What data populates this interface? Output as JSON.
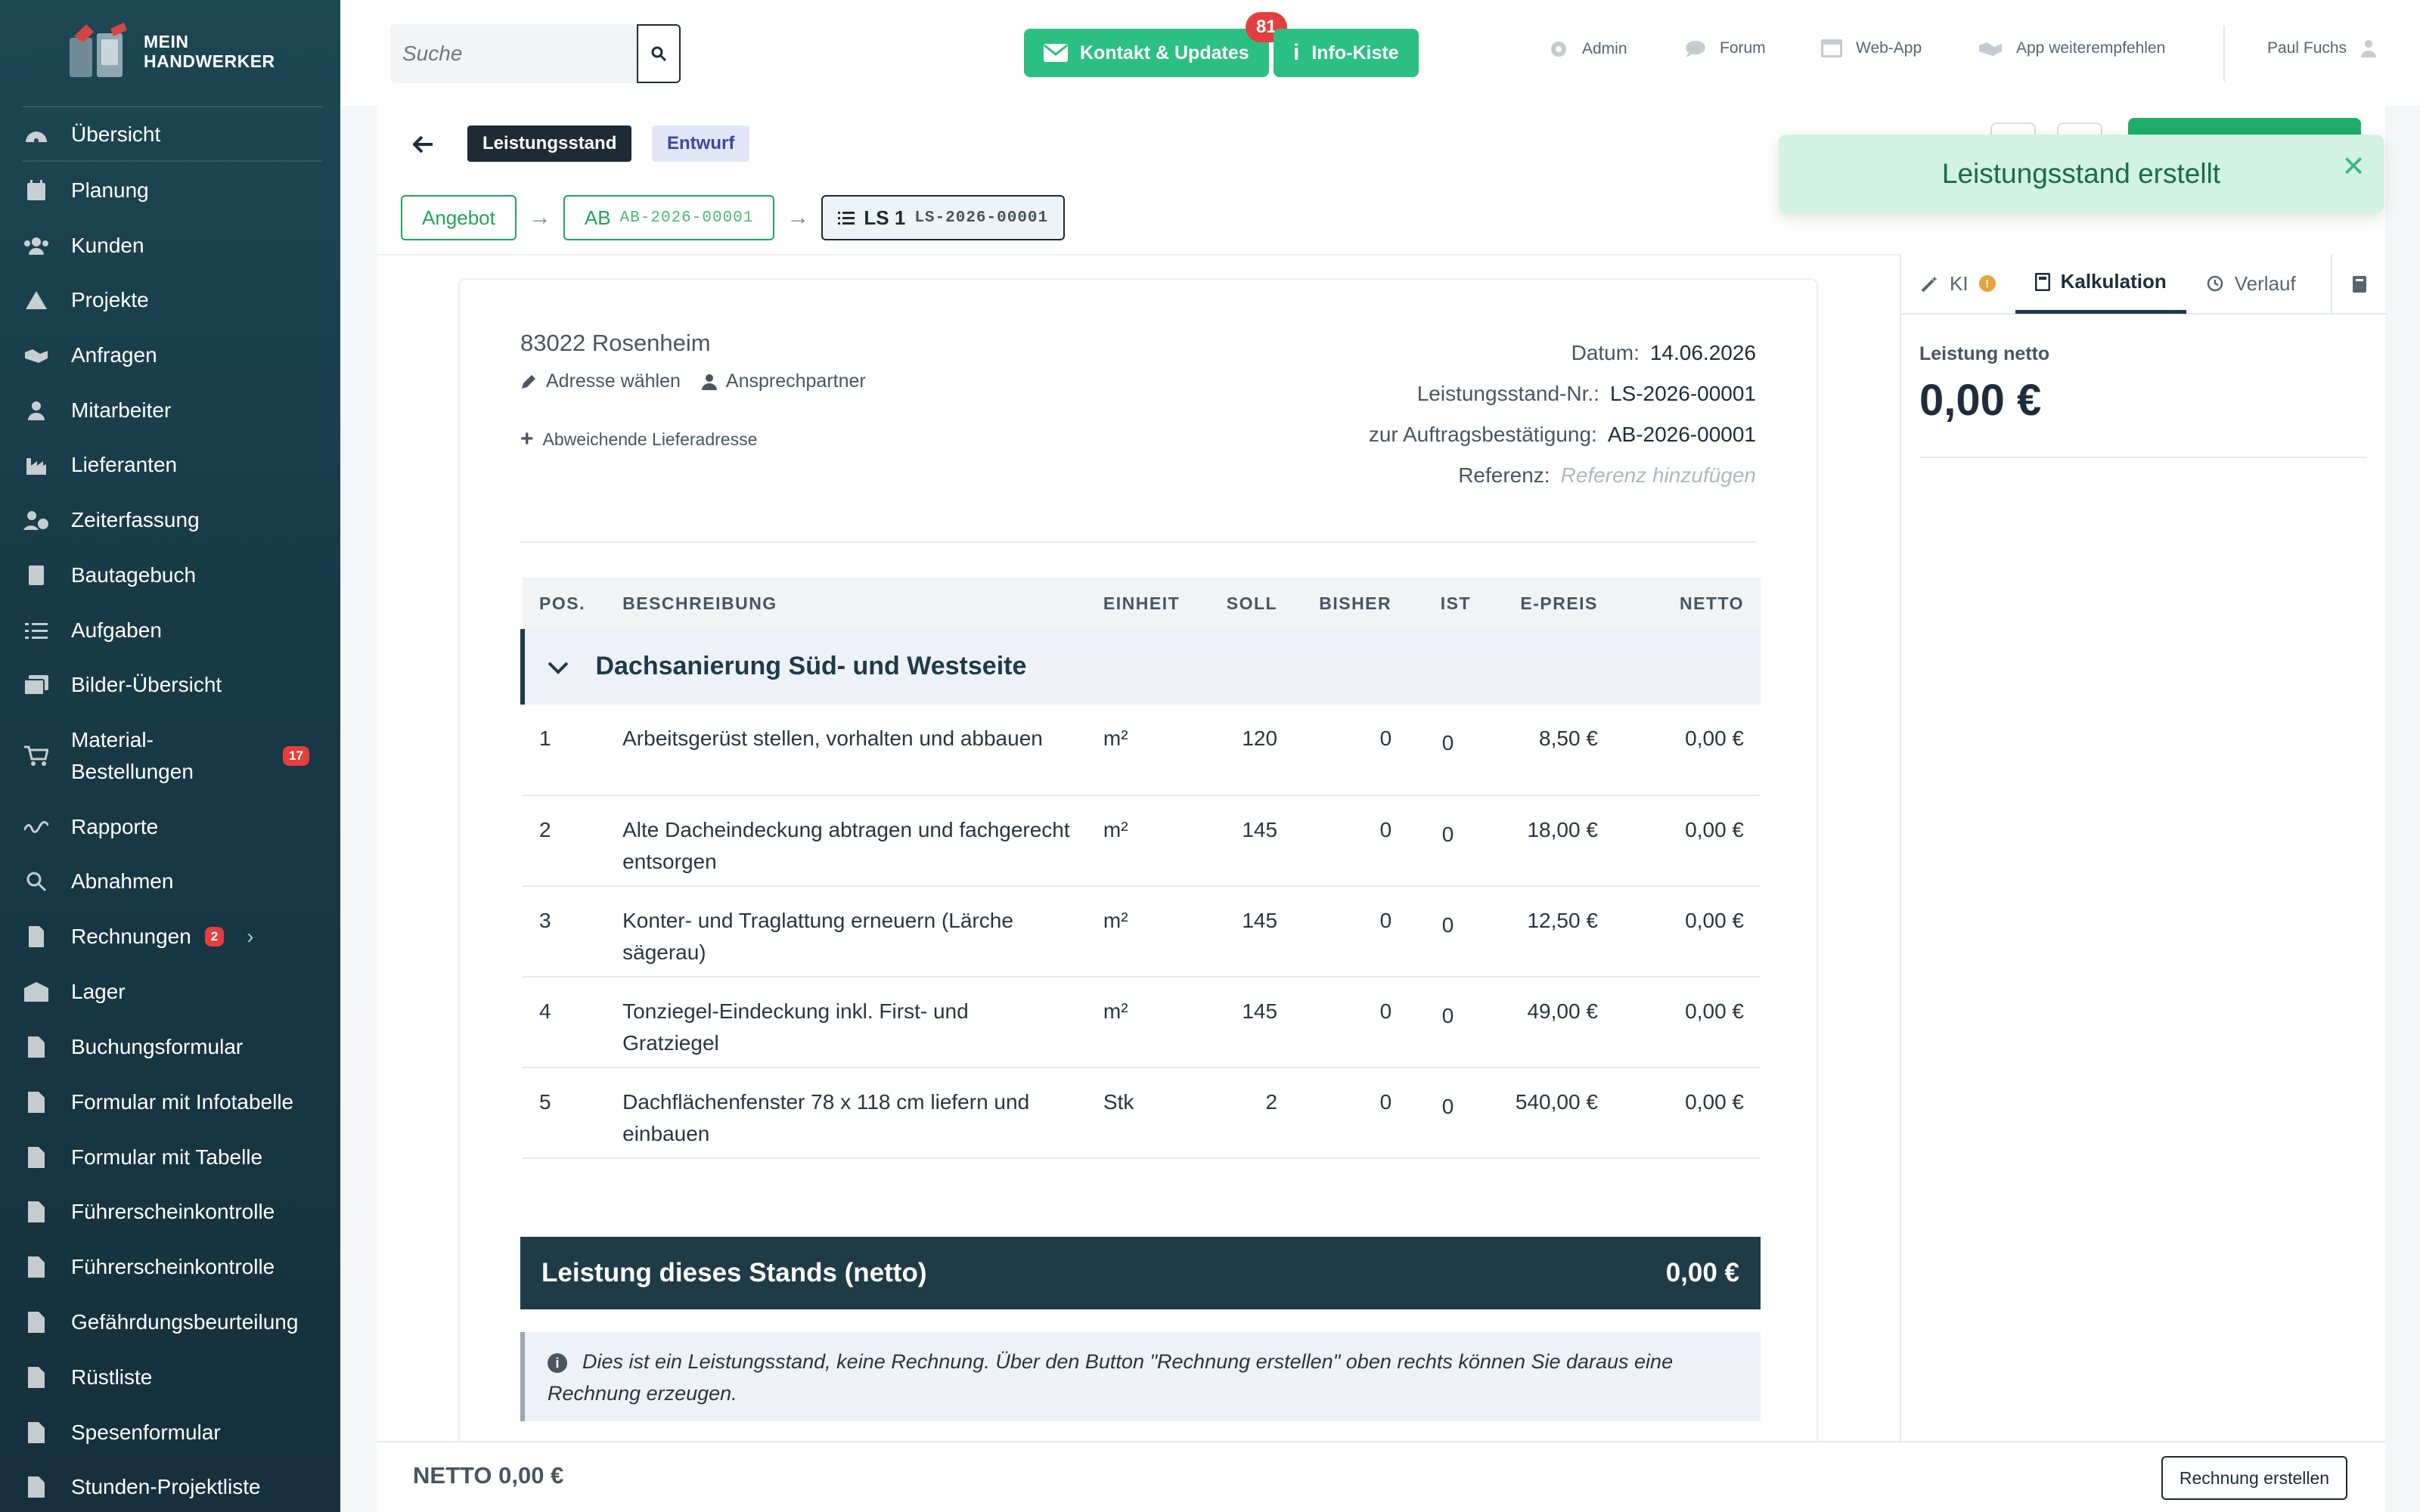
{
  "brand": {
    "line1": "MEIN",
    "line2": "HANDWERKER"
  },
  "sidebar": {
    "items": [
      {
        "label": "Übersicht",
        "icon": "dashboard-icon"
      },
      {
        "label": "Planung",
        "icon": "calendar-icon"
      },
      {
        "label": "Kunden",
        "icon": "users-icon"
      },
      {
        "label": "Projekte",
        "icon": "projects-icon"
      },
      {
        "label": "Anfragen",
        "icon": "handshake-icon"
      },
      {
        "label": "Mitarbeiter",
        "icon": "user-icon"
      },
      {
        "label": "Lieferanten",
        "icon": "industry-icon"
      },
      {
        "label": "Zeiterfassung",
        "icon": "user-clock-icon"
      },
      {
        "label": "Bautagebuch",
        "icon": "book-icon"
      },
      {
        "label": "Aufgaben",
        "icon": "tasks-icon"
      },
      {
        "label": "Bilder-Übersicht",
        "icon": "images-icon"
      },
      {
        "label": "Material-\nBestellungen",
        "icon": "cart-icon",
        "badge": "17"
      },
      {
        "label": "Rapporte",
        "icon": "signature-icon"
      },
      {
        "label": "Abnahmen",
        "icon": "search-icon"
      },
      {
        "label": "Rechnungen",
        "icon": "invoice-icon",
        "badge": "2"
      },
      {
        "label": "Lager",
        "icon": "warehouse-icon"
      },
      {
        "label": "Buchungsformular",
        "icon": "form-icon"
      },
      {
        "label": "Formular mit Infotabelle",
        "icon": "form-icon"
      },
      {
        "label": "Formular mit Tabelle",
        "icon": "form-icon"
      },
      {
        "label": "Führerscheinkontrolle",
        "icon": "form-icon"
      },
      {
        "label": "Führerscheinkontrolle",
        "icon": "form-icon"
      },
      {
        "label": "Gefährdungsbeurteilung",
        "icon": "form-icon"
      },
      {
        "label": "Rüstliste",
        "icon": "form-icon"
      },
      {
        "label": "Spesenformular",
        "icon": "form-icon"
      },
      {
        "label": "Stunden-Projektliste",
        "icon": "form-icon"
      }
    ]
  },
  "topbar": {
    "search_placeholder": "Suche",
    "contact_label": "Kontakt & Updates",
    "contact_badge": "81",
    "info_label": "Info-Kiste",
    "admin": "Admin",
    "forum": "Forum",
    "webapp": "Web-App",
    "recommend": "App weiterempfehlen",
    "user": "Paul Fuchs"
  },
  "doc": {
    "type_chip": "Leistungsstand",
    "status_chip": "Entwurf",
    "breadcrumb": {
      "angebot": "Angebot",
      "ab_label": "AB",
      "ab_number": "AB-2026-00001",
      "ls_label": "LS 1",
      "ls_number": "LS-2026-00001"
    },
    "address_city": "83022 Rosenheim",
    "choose_address": "Adresse wählen",
    "contact_person": "Ansprechpartner",
    "delivery_address": "Abweichende Lieferadresse",
    "meta": {
      "date_label": "Datum:",
      "date_value": "14.06.2026",
      "ls_nr_label": "Leistungsstand-Nr.:",
      "ls_nr_value": "LS-2026-00001",
      "ab_label": "zur Auftragsbestätigung:",
      "ab_value": "AB-2026-00001",
      "ref_label": "Referenz:",
      "ref_placeholder": "Referenz hinzufügen"
    },
    "columns": {
      "pos": "POS.",
      "desc": "BESCHREIBUNG",
      "unit": "EINHEIT",
      "soll": "SOLL",
      "bisher": "BISHER",
      "ist": "IST",
      "eprice": "E-PREIS",
      "netto": "NETTO"
    },
    "group_title": "Dachsanierung Süd- und Westseite",
    "rows": [
      {
        "pos": "1",
        "desc": "Arbeitsgerüst stellen, vorhalten und abbauen",
        "unit": "m²",
        "soll": "120",
        "bisher": "0",
        "ist": "0",
        "eprice": "8,50 €",
        "netto": "0,00 €"
      },
      {
        "pos": "2",
        "desc": "Alte Dacheindeckung abtragen und fachgerecht entsorgen",
        "unit": "m²",
        "soll": "145",
        "bisher": "0",
        "ist": "0",
        "eprice": "18,00 €",
        "netto": "0,00 €"
      },
      {
        "pos": "3",
        "desc": "Konter- und Traglattung erneuern (Lärche sägerau)",
        "unit": "m²",
        "soll": "145",
        "bisher": "0",
        "ist": "0",
        "eprice": "12,50 €",
        "netto": "0,00 €"
      },
      {
        "pos": "4",
        "desc": "Tonziegel-Eindeckung inkl. First- und Gratziegel",
        "unit": "m²",
        "soll": "145",
        "bisher": "0",
        "ist": "0",
        "eprice": "49,00 €",
        "netto": "0,00 €"
      },
      {
        "pos": "5",
        "desc": "Dachflächenfenster 78 x 118 cm liefern und einbauen",
        "unit": "Stk",
        "soll": "2",
        "bisher": "0",
        "ist": "0",
        "eprice": "540,00 €",
        "netto": "0,00 €"
      }
    ],
    "total_label": "Leistung dieses Stands (netto)",
    "total_value": "0,00 €",
    "info_text": "Dies ist ein Leistungsstand, keine Rechnung. Über den Button \"Rechnung erstellen\" oben rechts können Sie daraus eine Rechnung erzeugen."
  },
  "right_panel": {
    "tab_ki": "KI",
    "tab_kalkulation": "Kalkulation",
    "tab_verlauf": "Verlauf",
    "net_label": "Leistung netto",
    "net_value": "0,00 €"
  },
  "toast": {
    "message": "Leistungsstand erstellt"
  },
  "footer": {
    "net": "NETTO 0,00 €",
    "invoice_button": "Rechnung erstellen"
  },
  "colors": {
    "sidebar": "#1d4653",
    "accent_green": "#2bbf84",
    "dark": "#1e3b47",
    "badge_red": "#e53e3e"
  }
}
